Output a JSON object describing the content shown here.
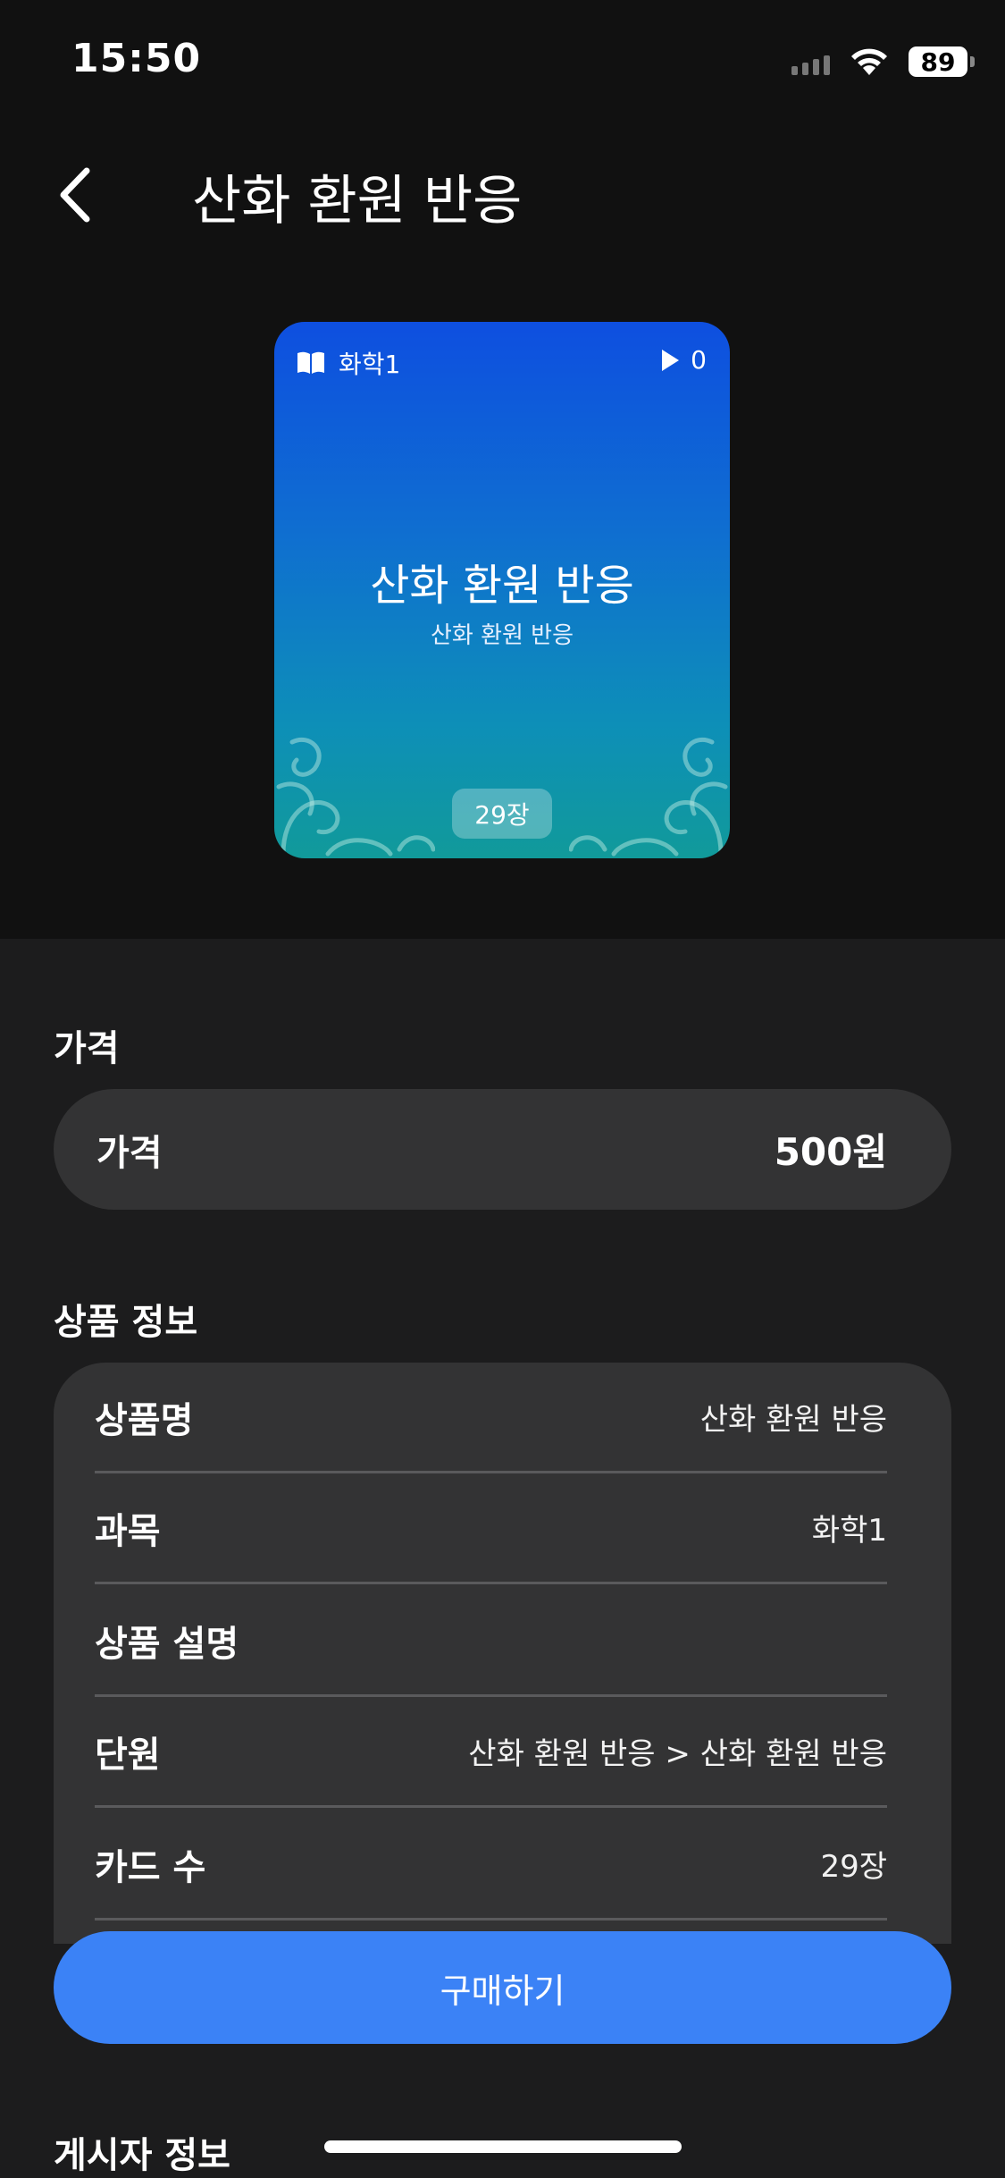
{
  "status_bar": {
    "time": "15:50",
    "battery": "89"
  },
  "header": {
    "title": "산화 환원 반응"
  },
  "card": {
    "subject": "화학1",
    "play_count": "0",
    "title": "산화 환원 반응",
    "subtitle": "산화 환원 반응",
    "card_count": "29장",
    "gradient_colors": [
      "#0e4fe0",
      "#119a9a"
    ]
  },
  "price_section": {
    "title": "가격",
    "label": "가격",
    "value": "500원"
  },
  "info_section": {
    "title": "상품 정보",
    "rows": [
      {
        "key": "상품명",
        "value": "산화 환원 반응"
      },
      {
        "key": "과목",
        "value": "화학1"
      },
      {
        "key": "상품 설명",
        "value": ""
      },
      {
        "key": "단원",
        "value": "산화 환원 반응 > 산화 환원 반응"
      },
      {
        "key": "카드 수",
        "value": "29장"
      }
    ]
  },
  "buy_button": {
    "label": "구매하기",
    "color": "#3b82f6"
  },
  "author_section": {
    "title": "게시자 정보"
  },
  "icons": [
    "back-chevron-icon",
    "book-icon",
    "play-icon",
    "wifi-icon",
    "signal-icon",
    "battery-icon"
  ]
}
